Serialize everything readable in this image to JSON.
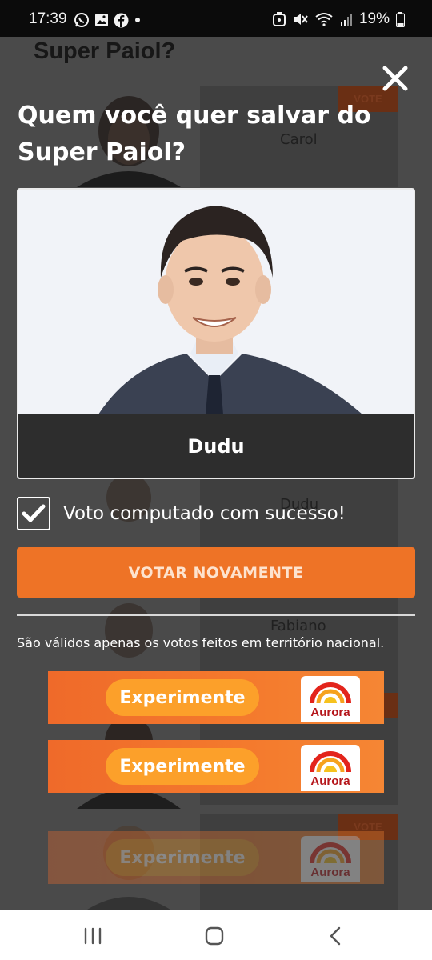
{
  "status_bar": {
    "time": "17:39",
    "battery": "19%",
    "left_icons": [
      "whatsapp-icon",
      "gallery-icon",
      "facebook-icon",
      "dot-icon"
    ],
    "right_icons": [
      "alarm-icon",
      "mute-icon",
      "wifi-icon",
      "signal-icon",
      "battery-icon"
    ]
  },
  "background_page": {
    "title": "Super Paiol?",
    "vote_label": "VOTE",
    "candidates": [
      "Carol",
      "Dudu",
      "Fabiano"
    ]
  },
  "modal": {
    "title": "Quem você quer salvar do Super Paiol?",
    "candidate_name": "Dudu",
    "success_message": "Voto computado com sucesso!",
    "vote_again_label": "VOTAR NOVAMENTE",
    "disclaimer": "São válidos apenas os votos feitos em território nacional."
  },
  "ads": {
    "cta": "Experimente",
    "brand": "Aurora",
    "colors": {
      "orange": "#f47a2d",
      "pill": "#fca02a",
      "brand_red": "#b5161b"
    }
  },
  "colors": {
    "accent": "#ee7326",
    "name_bar": "#2d2d2d"
  },
  "nav_bar": {
    "icons": [
      "recents-icon",
      "home-icon",
      "back-icon"
    ]
  }
}
